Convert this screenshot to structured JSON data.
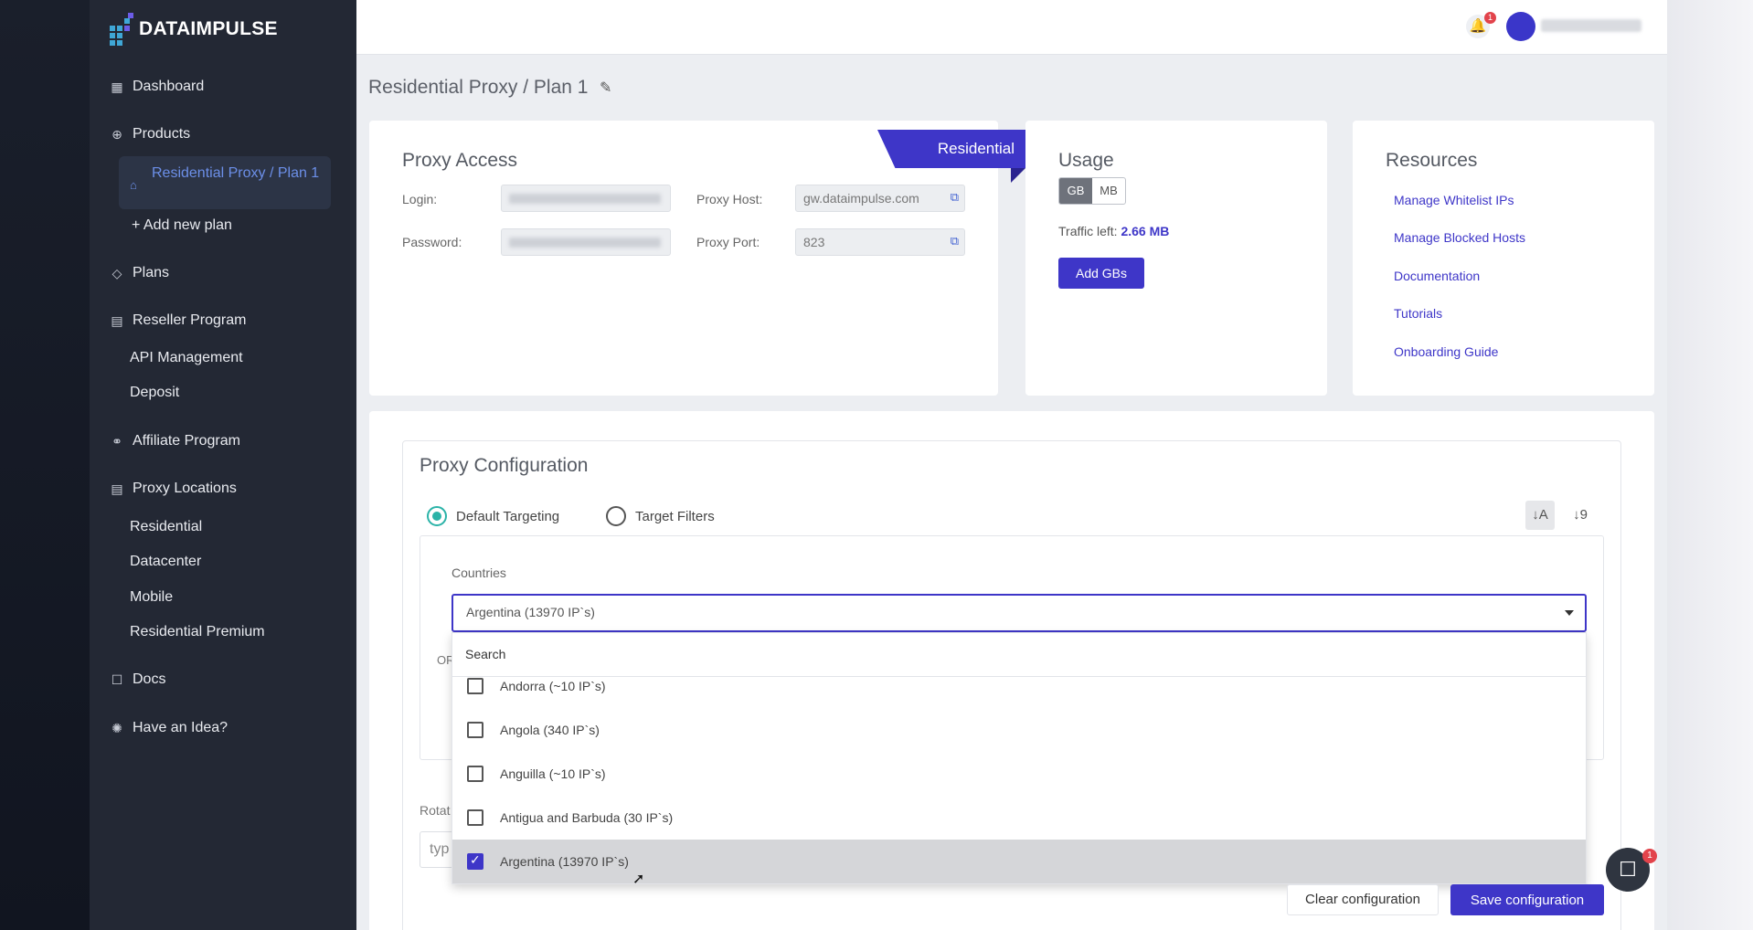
{
  "brand": {
    "name": "DATAIMPULSE",
    "accent": "#3e36c8",
    "sidebar_bg": "#232834"
  },
  "sidebar": {
    "dashboard": "Dashboard",
    "products": "Products",
    "active_plan": "Residential Proxy / Plan 1",
    "add_plan": "+ Add new plan",
    "plans": "Plans",
    "reseller": "Reseller Program",
    "api_management": "API Management",
    "deposit": "Deposit",
    "affiliate": "Affiliate Program",
    "proxy_locations": "Proxy Locations",
    "residential": "Residential",
    "datacenter": "Datacenter",
    "mobile": "Mobile",
    "residential_premium": "Residential Premium",
    "docs": "Docs",
    "idea": "Have an Idea?"
  },
  "header": {
    "notification_count": "1",
    "chat_badge": "1"
  },
  "page": {
    "title": "Residential Proxy / Plan 1"
  },
  "proxy_access": {
    "title": "Proxy Access",
    "ribbon": "Residential",
    "login_label": "Login:",
    "password_label": "Password:",
    "host_label": "Proxy Host:",
    "host_value": "gw.dataimpulse.com",
    "port_label": "Proxy Port:",
    "port_value": "823"
  },
  "usage": {
    "title": "Usage",
    "unit_gb": "GB",
    "unit_mb": "MB",
    "selected_unit": "GB",
    "traffic_label": "Traffic left:",
    "traffic_value": "2.66 MB",
    "add_button": "Add GBs"
  },
  "resources": {
    "title": "Resources",
    "links": [
      "Manage Whitelist IPs",
      "Manage Blocked Hosts",
      "Documentation",
      "Tutorials",
      "Onboarding Guide"
    ]
  },
  "proxy_config": {
    "title": "Proxy Configuration",
    "default_targeting": "Default Targeting",
    "target_filters": "Target Filters",
    "selected_mode": "Default Targeting",
    "countries_label": "Countries",
    "selected_country": "Argentina (13970 IP`s)",
    "or_label": "OR",
    "rotation_label": "Rotat",
    "rotation_placeholder": "typ",
    "search_placeholder": "Search",
    "countries": [
      {
        "label": "Andorra (~10 IP`s)",
        "checked": false
      },
      {
        "label": "Angola (340 IP`s)",
        "checked": false
      },
      {
        "label": "Anguilla (~10 IP`s)",
        "checked": false
      },
      {
        "label": "Antigua and Barbuda (30 IP`s)",
        "checked": false
      },
      {
        "label": "Argentina (13970 IP`s)",
        "checked": true
      }
    ],
    "clear_button": "Clear configuration",
    "save_button": "Save configuration"
  }
}
